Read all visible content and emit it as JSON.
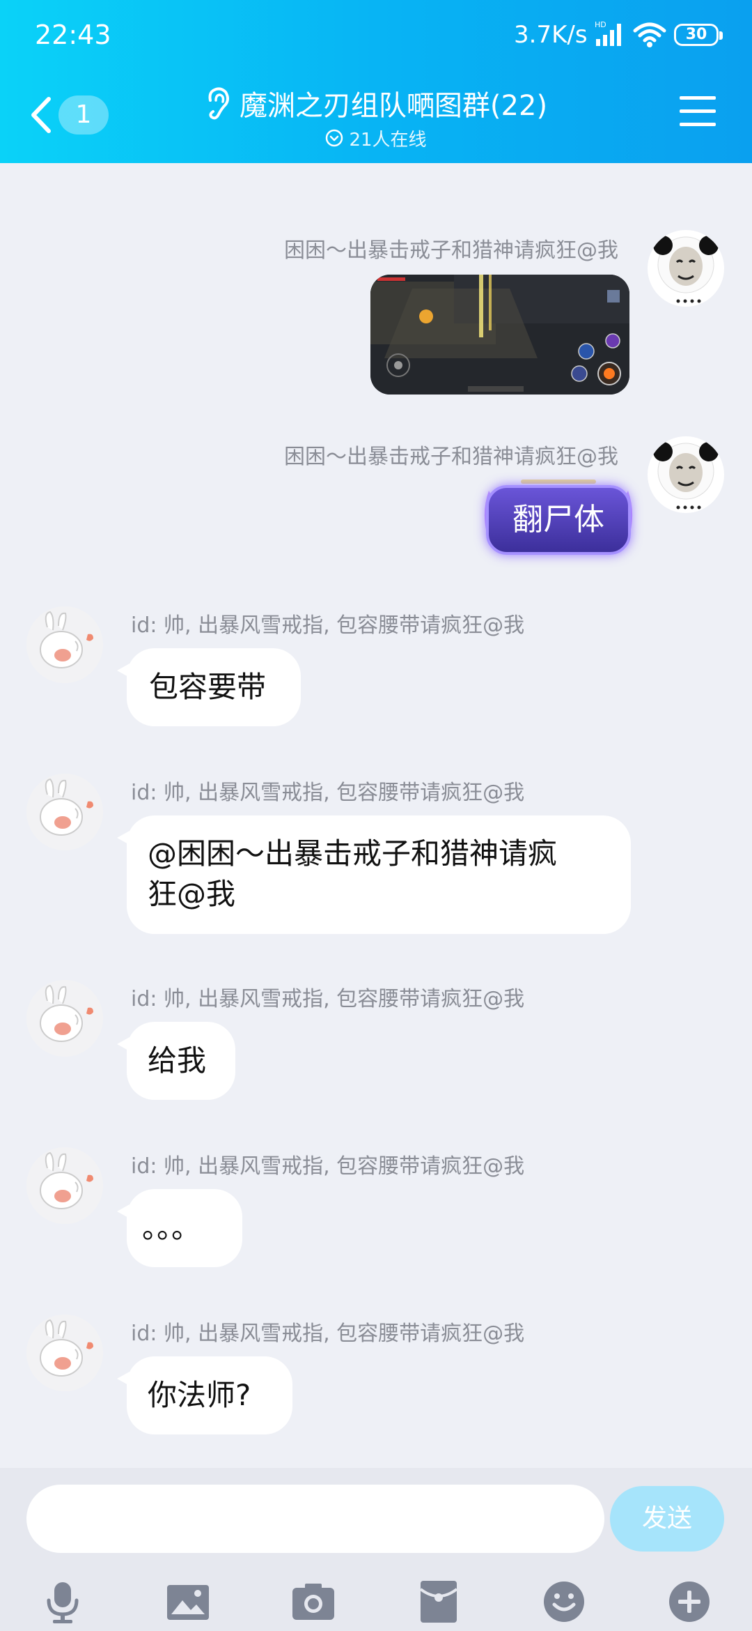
{
  "status": {
    "time": "22:43",
    "net_speed": "3.7K/s",
    "signal_label": "HD",
    "battery": "30"
  },
  "header": {
    "back_badge": "1",
    "title": "魔渊之刃组队嗮图群(22)",
    "online": "21人在线"
  },
  "messages": [
    {
      "side": "right",
      "sender": "困困～出暴击戒子和猎神请疯狂@我",
      "type": "image",
      "avatar": "panda-meme"
    },
    {
      "side": "right",
      "sender": "困困～出暴击戒子和猎神请疯狂@我",
      "type": "text",
      "text": "翻尸体",
      "avatar": "panda-meme"
    },
    {
      "side": "left",
      "sender": "id: 帅, 出暴风雪戒指, 包容腰带请疯狂@我",
      "type": "text",
      "text": "包容要带"
    },
    {
      "side": "left",
      "sender": "id: 帅, 出暴风雪戒指, 包容腰带请疯狂@我",
      "type": "text",
      "text_line1": "@困困～出暴击戒子和猎神请疯",
      "text_line2": "狂@我"
    },
    {
      "side": "left",
      "sender": "id: 帅, 出暴风雪戒指, 包容腰带请疯狂@我",
      "type": "text",
      "text": "给我"
    },
    {
      "side": "left",
      "sender": "id: 帅, 出暴风雪戒指, 包容腰带请疯狂@我",
      "type": "text",
      "text": "。。。"
    },
    {
      "side": "left",
      "sender": "id: 帅, 出暴风雪戒指, 包容腰带请疯狂@我",
      "type": "text",
      "text": "你法师?"
    }
  ],
  "input": {
    "placeholder": "",
    "send_label": "发送"
  },
  "toolbar": [
    "microphone-icon",
    "image-icon",
    "camera-icon",
    "red-packet-icon",
    "emoji-icon",
    "plus-icon"
  ],
  "colors": {
    "header_start": "#0ad2f8",
    "header_end": "#0aa0ef",
    "background": "#eef0f6",
    "send_button": "#a6e4fb",
    "tool_icon": "#7d8494"
  }
}
